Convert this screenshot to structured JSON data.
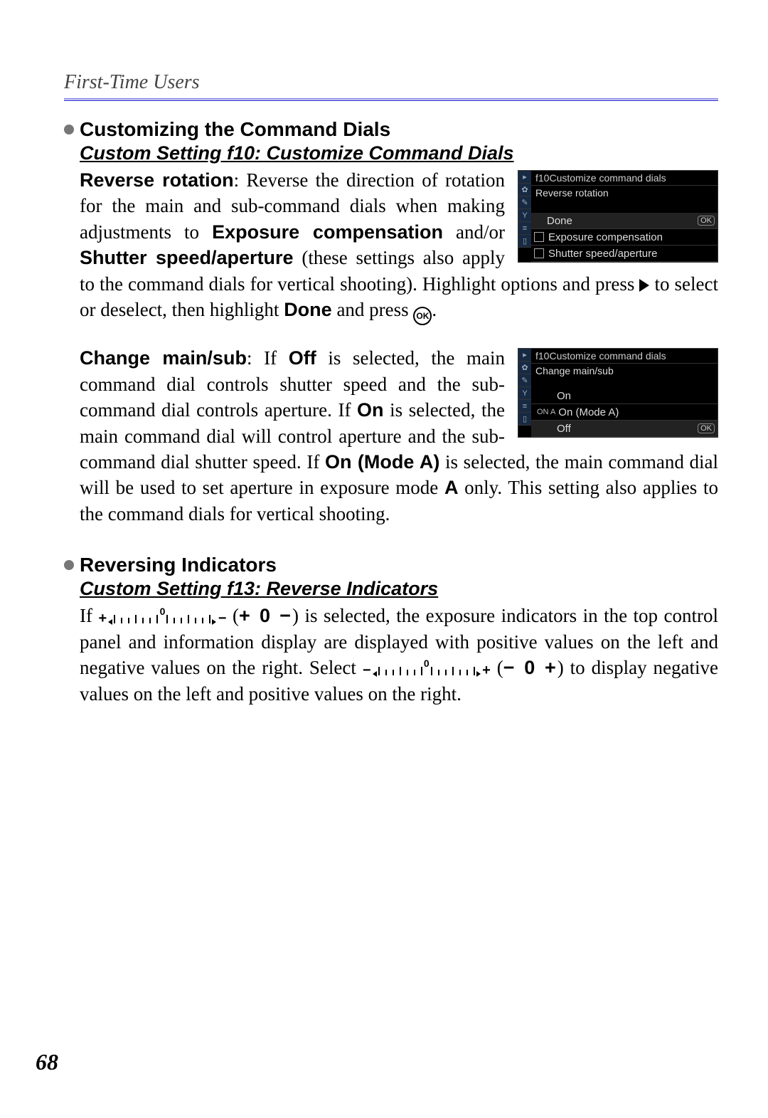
{
  "header": {
    "title": "First-Time Users"
  },
  "sections": {
    "s1": {
      "heading": "Customizing the Command Dials",
      "subsetting": "Custom Setting f10: Customize Command Dials",
      "p1": {
        "lead": "Reverse rotation",
        "t1": ": Reverse the direction of rotation for the main and sub-command dials when making adjustments to ",
        "b1": "Exposure compensation",
        "t2": " and/or ",
        "b2": "Shutter speed/aperture",
        "t3": " (these settings also apply to the command dials for vertical shooting). Highlight options and press ",
        "t4": " to select or deselect, then highlight ",
        "b3": "Done",
        "t5": " and press ",
        "t6": "."
      },
      "menu1": {
        "path": "f10Customize command dials",
        "title": "Reverse rotation",
        "done": "Done",
        "ok": "OK",
        "opt1": "Exposure compensation",
        "opt2": "Shutter speed/aperture"
      },
      "p2": {
        "lead": "Change main/sub",
        "t1": ": If ",
        "b1": "Off",
        "t2": " is selected, the main command dial controls shutter speed and the sub-command dial controls aperture. If ",
        "b2": "On",
        "t3": " is selected, the main command dial will control aperture and the sub-command dial shutter speed. If ",
        "b3": "On (Mode A)",
        "t4": " is selected, the main command dial will be used to set aperture in exposure mode ",
        "modeA": "A",
        "t5": " only. This setting also applies to the command dials for vertical shooting."
      },
      "menu2": {
        "path": "f10Customize command dials",
        "title": "Change main/sub",
        "on": "On",
        "onA_prefix": "ON A",
        "onA": "On (Mode A)",
        "off": "Off",
        "ok": "OK"
      }
    },
    "s2": {
      "heading": "Reversing Indicators",
      "subsetting": "Custom Setting f13: Reverse Indicators",
      "p1": {
        "t1": "If ",
        "ind1_label": "+ 0 −",
        "t2": " (",
        "ind1_short": "+ 0 −",
        "t3": ") is selected, the exposure indicators in the top control panel and information display are displayed with positive values on the left and negative values on the right. Select ",
        "ind2_label": "− 0 +",
        "t4": " (",
        "ind2_short": "− 0 +",
        "t5": ") to display negative values on the left and positive values on the right."
      }
    }
  },
  "icons": {
    "ok_text": "OK"
  },
  "page_number": "68"
}
